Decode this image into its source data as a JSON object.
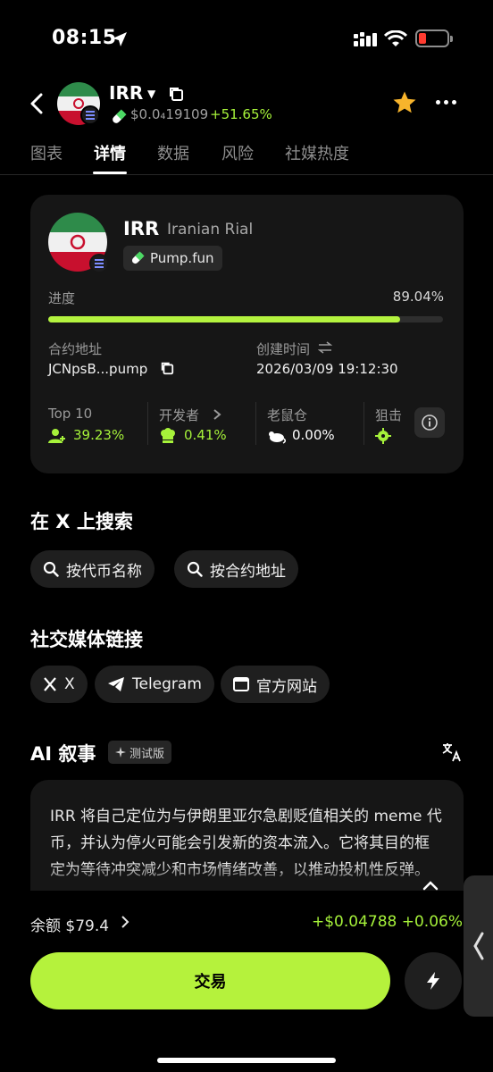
{
  "status_bar": {
    "time": "08:15"
  },
  "header": {
    "symbol": "IRR",
    "price": "$0.0₄19109",
    "change": "+51.65%",
    "colors": {
      "positive": "#a6f23a",
      "favorite": "#f7b42c"
    },
    "icons": [
      "back-arrow-icon",
      "dropdown-caret-icon",
      "copy-icon",
      "pill-icon",
      "star-icon",
      "more-icon"
    ]
  },
  "tabs": [
    {
      "label": "图表"
    },
    {
      "label": "详情"
    },
    {
      "label": "数据"
    },
    {
      "label": "风险"
    },
    {
      "label": "社媒热度"
    }
  ],
  "active_tab": "详情",
  "token_card": {
    "symbol": "IRR",
    "name": "Iranian Rial",
    "launchpad": "Pump.fun",
    "progress_label": "进度",
    "progress_value": "89.04%",
    "progress_fraction": 0.8904,
    "contract_label": "合约地址",
    "contract_value": "JCNpsB...pump",
    "created_label": "创建时间",
    "created_value": "2026/03/09 19:12:30",
    "stats": [
      {
        "label": "Top 10",
        "value": "39.23%",
        "color": "#a6f23a",
        "icon": "user-icon"
      },
      {
        "label": "开发者",
        "value": "0.41%",
        "color": "#a6f23a",
        "icon": "chef-hat-icon"
      },
      {
        "label": "老鼠仓",
        "value": "0.00%",
        "color": "#ffffff",
        "icon": "rat-icon"
      },
      {
        "label": "狙击",
        "value": "",
        "color": "#a6f23a",
        "icon": "crosshair-icon"
      }
    ]
  },
  "search_x": {
    "title": "在 X 上搜索",
    "by_name": "按代币名称",
    "by_contract": "按合约地址"
  },
  "social": {
    "title": "社交媒体链接",
    "x": "X",
    "telegram": "Telegram",
    "website": "官方网站"
  },
  "narrative": {
    "title": "AI 叙事",
    "beta": "测试版",
    "text": "IRR 将自己定位为与伊朗里亚尔急剧贬值相关的 meme 代币，并认为停火可能会引发新的资本流入。它将其目的框定为等待冲突减少和市场情绪改善，以推动投机性反弹。"
  },
  "bottom": {
    "balance": "余额 $79.4",
    "pnl": "+$0.04788 +0.06%",
    "trade": "交易"
  }
}
